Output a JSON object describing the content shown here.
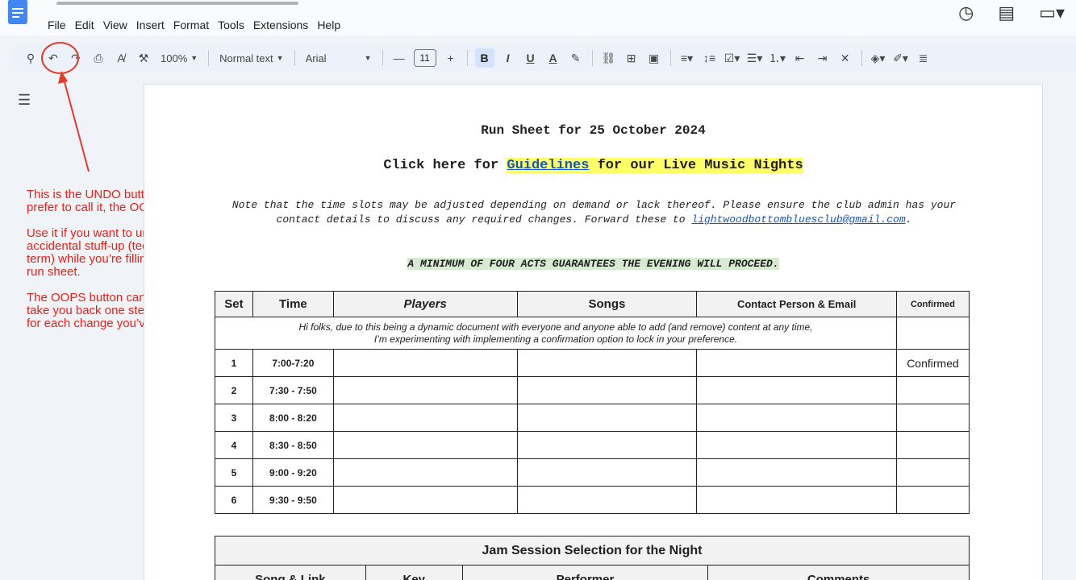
{
  "menu": [
    "File",
    "Edit",
    "View",
    "Insert",
    "Format",
    "Tools",
    "Extensions",
    "Help"
  ],
  "toolbar": {
    "zoom": "100%",
    "style": "Normal text",
    "font": "Arial",
    "font_size": "11",
    "bold": "B",
    "italic": "I",
    "underline": "U",
    "text_color": "A"
  },
  "annotation": {
    "p1": "This is the UNDO button, or as I prefer to call it, the OOPS button.",
    "p2": "Use it if you want to undo some accidental stuff-up (technical term) while you’re filling out the run sheet.",
    "p3": "The OOPS button can be used to take you back one step at a time, for each change you’ve made.",
    "color": "#e62117"
  },
  "doc": {
    "title": "Run Sheet for 25 October 2024",
    "link_prefix": "Click here for ",
    "link_text": "Guidelines",
    "link_suffix": " for our Live Music Nights",
    "note_text": "Note that the time slots may be adjusted depending on demand or lack thereof. Please ensure the club admin has your contact details to discuss any required changes. Forward these to ",
    "email": "lightwoodbottombluesclub@gmail.com",
    "note_end": ".",
    "minimum": "A MINIMUM OF FOUR ACTS GUARANTEES THE EVENING WILL PROCEED."
  },
  "run_table": {
    "headers": [
      "Set",
      "Time",
      "Players",
      "Songs",
      "Contact Person & Email",
      "Confirmed"
    ],
    "info_line1": "Hi folks, due to this being a dynamic document with everyone and anyone able to add (and remove) content at any time,",
    "info_line2": "I’m experimenting with implementing a confirmation option to lock in your preference.",
    "rows": [
      {
        "set": "1",
        "time": "7:00-7:20",
        "confirmed": "Confirmed"
      },
      {
        "set": "2",
        "time": "7:30 - 7:50",
        "confirmed": ""
      },
      {
        "set": "3",
        "time": "8:00 - 8:20",
        "confirmed": ""
      },
      {
        "set": "4",
        "time": "8:30 - 8:50",
        "confirmed": ""
      },
      {
        "set": "5",
        "time": "9:00 - 9:20",
        "confirmed": ""
      },
      {
        "set": "6",
        "time": "9:30 - 9:50",
        "confirmed": ""
      }
    ]
  },
  "jam_table": {
    "title": "Jam Session Selection for the Night",
    "headers": [
      "Song & Link",
      "Key",
      "Performer",
      "Comments"
    ]
  }
}
